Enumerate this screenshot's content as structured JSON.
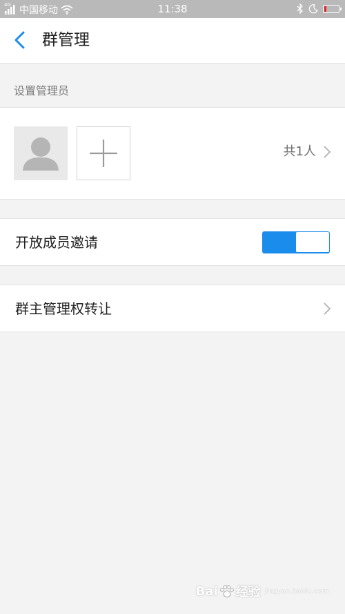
{
  "status_bar": {
    "signal_tag": "4G",
    "carrier": "中国移动",
    "time": "11:38",
    "icons": [
      "signal-icon",
      "wifi-icon",
      "bluetooth-icon",
      "moon-icon",
      "battery-icon"
    ],
    "battery_level_percent": 15,
    "battery_color": "#e02525"
  },
  "header": {
    "back_icon": "chevron-left-icon",
    "title": "群管理",
    "accent_color": "#1a8ceb"
  },
  "admins": {
    "section_label": "设置管理员",
    "avatar_icon": "person-placeholder-icon",
    "add_icon": "plus-icon",
    "member_count": "共1人",
    "chevron_icon": "chevron-right-icon"
  },
  "open_invite": {
    "label": "开放成员邀请",
    "toggle_on": true,
    "toggle_color": "#1a8ceb"
  },
  "transfer": {
    "label": "群主管理权转让",
    "chevron_icon": "chevron-right-icon"
  },
  "watermark": {
    "text": "Bai",
    "paw_icon": "paw-icon",
    "suffix": "经验",
    "sub": "jingyan.baidu.com"
  }
}
